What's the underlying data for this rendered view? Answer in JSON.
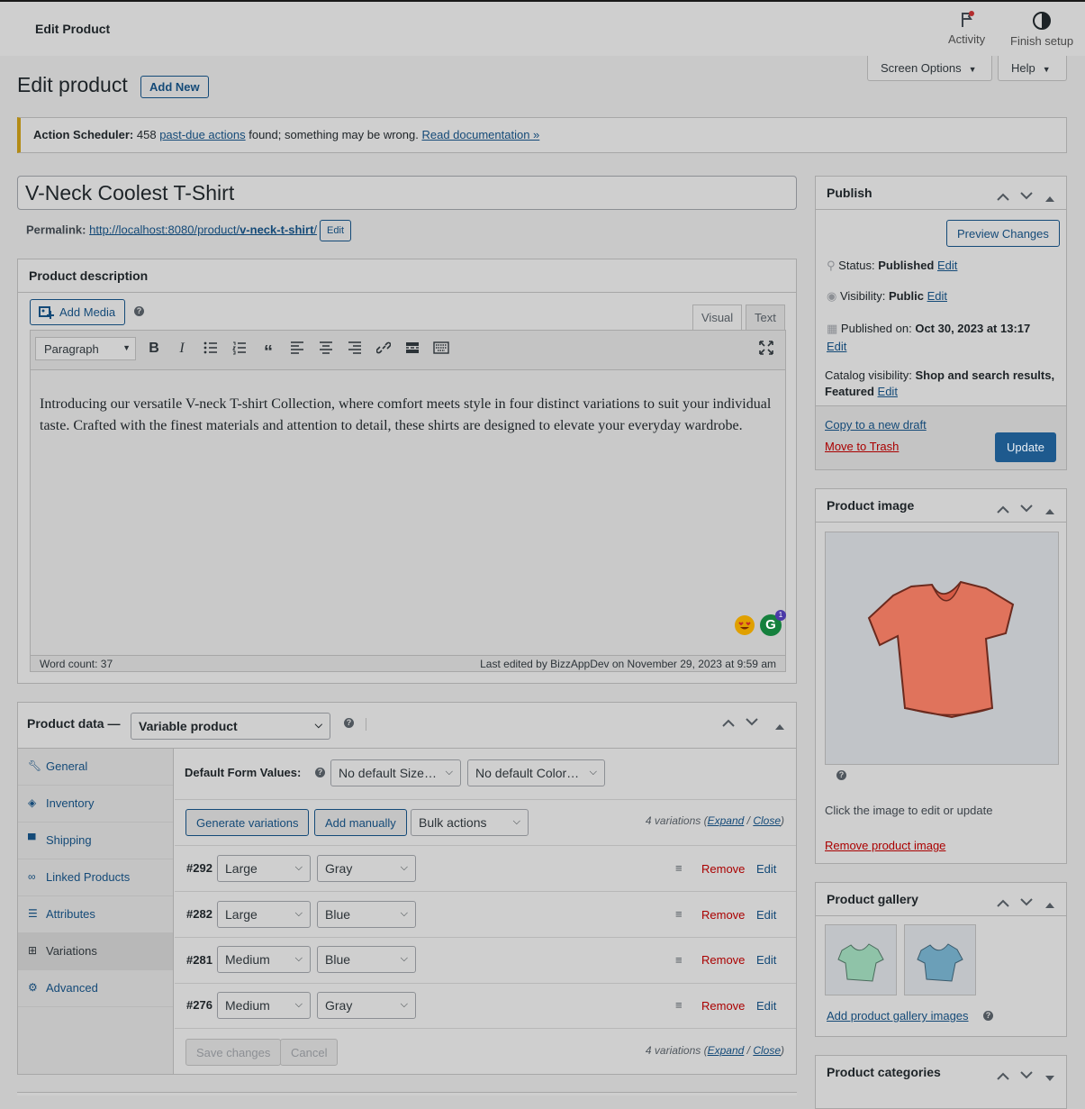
{
  "topbar": {
    "title": "Edit Product",
    "activity_label": "Activity",
    "finish_setup_label": "Finish setup",
    "screen_options_label": "Screen Options",
    "help_label": "Help"
  },
  "header": {
    "page_title": "Edit product",
    "add_new_label": "Add New"
  },
  "notice": {
    "prefix_bold": "Action Scheduler:",
    "count": "458",
    "link1": "past-due actions",
    "middle": "found; something may be wrong.",
    "link2": "Read documentation »"
  },
  "product": {
    "title": "V-Neck Coolest T-Shirt",
    "permalink_label": "Permalink:",
    "permalink_base": "http://localhost:8080/product/",
    "permalink_slug": "v-neck-t-shirt",
    "permalink_trail": "/",
    "permalink_edit": "Edit"
  },
  "description": {
    "box_title": "Product description",
    "add_media_label": "Add Media",
    "tab_visual": "Visual",
    "tab_text": "Text",
    "format_value": "Paragraph",
    "content": "Introducing our versatile V-neck T-shirt Collection, where comfort meets style in four distinct variations to suit your individual taste. Crafted with the finest materials and attention to detail, these shirts are designed to elevate your everyday wardrobe.",
    "word_count": "Word count: 37",
    "last_edited": "Last edited by BizzAppDev on November 29, 2023 at 9:59 am",
    "grammarly_badge": "1"
  },
  "product_data": {
    "label": "Product data —",
    "type_value": "Variable product",
    "tabs": [
      {
        "label": "General",
        "icon": "wrench-icon"
      },
      {
        "label": "Inventory",
        "icon": "tag-icon"
      },
      {
        "label": "Shipping",
        "icon": "truck-icon"
      },
      {
        "label": "Linked Products",
        "icon": "link-icon"
      },
      {
        "label": "Attributes",
        "icon": "list-icon"
      },
      {
        "label": "Variations",
        "icon": "grid-icon"
      },
      {
        "label": "Advanced",
        "icon": "gear-icon"
      }
    ],
    "default_form_label": "Default Form Values:",
    "default_size": "No default Size…",
    "default_color": "No default Color…",
    "generate_label": "Generate variations",
    "add_manually_label": "Add manually",
    "bulk_actions_label": "Bulk actions",
    "variations_count_prefix": "4 variations (",
    "expand_label": "Expand",
    "separator": " / ",
    "close_label": "Close",
    "variations_count_suffix": ")",
    "variations": [
      {
        "id": "#292",
        "size": "Large",
        "color": "Gray"
      },
      {
        "id": "#282",
        "size": "Large",
        "color": "Blue"
      },
      {
        "id": "#281",
        "size": "Medium",
        "color": "Blue"
      },
      {
        "id": "#276",
        "size": "Medium",
        "color": "Gray"
      }
    ],
    "remove_label": "Remove",
    "edit_label": "Edit",
    "save_label": "Save changes",
    "cancel_label": "Cancel"
  },
  "publish": {
    "title": "Publish",
    "preview_label": "Preview Changes",
    "status_label": "Status:",
    "status_value": "Published",
    "visibility_label": "Visibility:",
    "visibility_value": "Public",
    "published_label": "Published on:",
    "published_value": "Oct 30, 2023 at 13:17",
    "catalog_label": "Catalog visibility:",
    "catalog_value": "Shop and search results, Featured",
    "edit_label": "Edit",
    "copy_label": "Copy to a new draft",
    "trash_label": "Move to Trash",
    "update_label": "Update"
  },
  "product_image": {
    "title": "Product image",
    "hint": "Click the image to edit or update",
    "remove_label": "Remove product image"
  },
  "gallery": {
    "title": "Product gallery",
    "add_label": "Add product gallery images"
  },
  "categories": {
    "title": "Product categories"
  },
  "colors": {
    "link": "#144a78",
    "danger": "#aa0000",
    "primary": "#1e5a8e",
    "notice_border": "#b38b15"
  }
}
